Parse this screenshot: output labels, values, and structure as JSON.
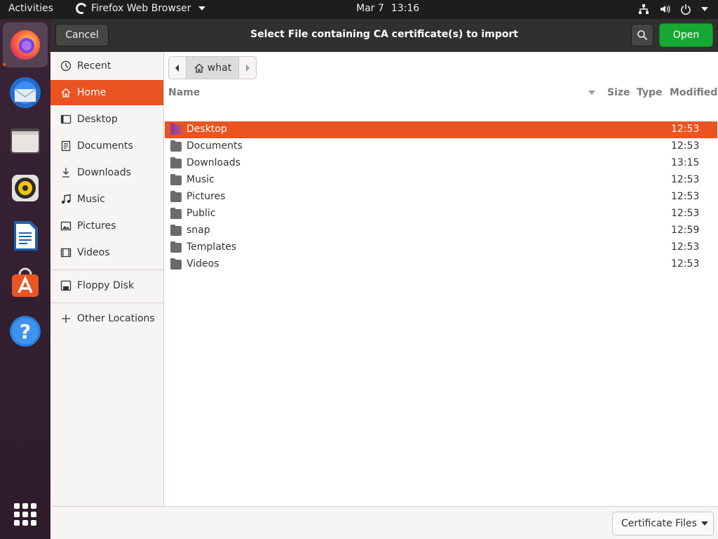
{
  "topbar": {
    "activities": "Activities",
    "app_name": "Firefox Web Browser",
    "date": "Mar 7",
    "time": "13:16"
  },
  "dock": {
    "items": [
      "firefox-icon",
      "thunderbird-icon",
      "files-icon",
      "rhythmbox-icon",
      "libreoffice-writer-icon",
      "ubuntu-software-icon",
      "help-icon"
    ]
  },
  "dialog": {
    "title": "Select File containing CA certificate(s) to import",
    "cancel_label": "Cancel",
    "open_label": "Open",
    "accent": "#e95420",
    "open_color": "#17a834"
  },
  "sidebar": {
    "items": [
      {
        "label": "Recent",
        "icon": "clock-icon"
      },
      {
        "label": "Home",
        "icon": "home-icon"
      },
      {
        "label": "Desktop",
        "icon": "desktop-icon"
      },
      {
        "label": "Documents",
        "icon": "document-icon"
      },
      {
        "label": "Downloads",
        "icon": "download-icon"
      },
      {
        "label": "Music",
        "icon": "music-icon"
      },
      {
        "label": "Pictures",
        "icon": "picture-icon"
      },
      {
        "label": "Videos",
        "icon": "video-icon"
      },
      {
        "label": "Floppy Disk",
        "icon": "floppy-icon"
      },
      {
        "label": "Other Locations",
        "icon": "plus-icon"
      }
    ],
    "selected": "Home"
  },
  "pathbar": {
    "crumb": "what"
  },
  "filelist": {
    "columns": {
      "name": "Name",
      "size": "Size",
      "type": "Type",
      "modified": "Modified"
    },
    "rows": [
      {
        "name": "Desktop",
        "modified": "12:53"
      },
      {
        "name": "Documents",
        "modified": "12:53"
      },
      {
        "name": "Downloads",
        "modified": "13:15"
      },
      {
        "name": "Music",
        "modified": "12:53"
      },
      {
        "name": "Pictures",
        "modified": "12:53"
      },
      {
        "name": "Public",
        "modified": "12:53"
      },
      {
        "name": "snap",
        "modified": "12:59"
      },
      {
        "name": "Templates",
        "modified": "12:53"
      },
      {
        "name": "Videos",
        "modified": "12:53"
      }
    ],
    "selected": "Desktop"
  },
  "footer": {
    "filter": "Certificate Files"
  }
}
